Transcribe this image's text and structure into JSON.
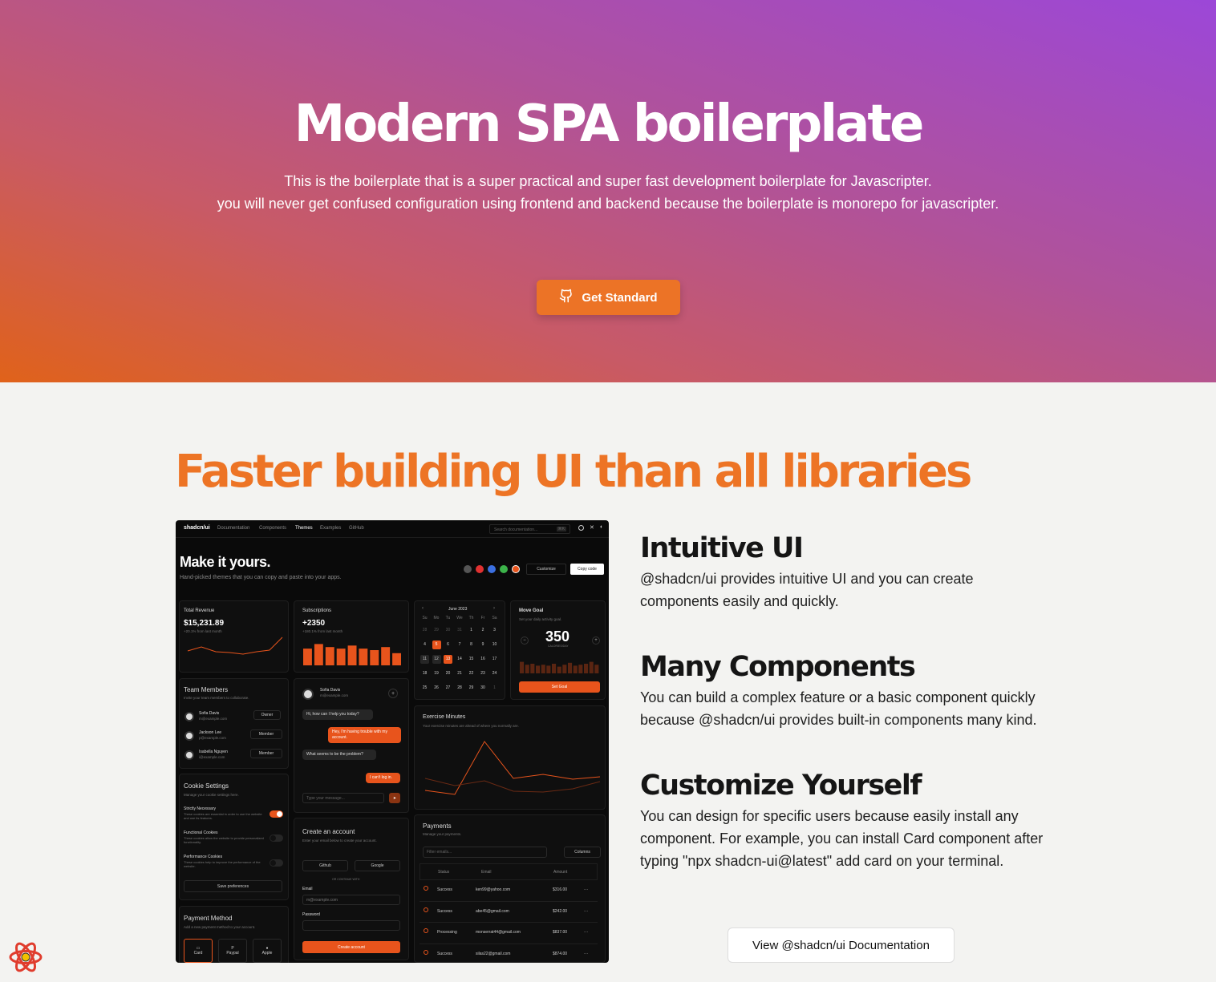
{
  "hero": {
    "title": "Modern SPA boilerplate",
    "subtitle_line1": "This is the boilerplate that is a super practical and super fast development boilerplate for Javascripter.",
    "subtitle_line2": "you will never get confused configuration using frontend and backend because the boilerplate is monorepo for javascripter.",
    "cta_label": "Get Standard",
    "cta_icon": "github-icon"
  },
  "section": {
    "title": "Faster building UI than all libraries"
  },
  "features": [
    {
      "title": "Intuitive UI",
      "text": "@shadcn/ui provides intuitive UI and you can create components easily and quickly."
    },
    {
      "title": "Many Components",
      "text": "You can build a complex feature or a basic component quickly because @shadcn/ui provides built-in components many kind."
    },
    {
      "title": "Customize Yourself",
      "text": "You can design for specific users because easily install any component. For example, you can install Card component after typing \"npx shadcn-ui@latest\" add card on your terminal."
    }
  ],
  "docs_button": "View @shadcn/ui Documentation",
  "colors": {
    "accent": "#ec7326",
    "title_orange": "#ed7425",
    "mock_orange": "#e8541c"
  },
  "mock": {
    "nav": {
      "brand": "shadcn/ui",
      "items": [
        "Documentation",
        "Components",
        "Themes",
        "Examples",
        "GitHub"
      ],
      "search": "Search documentation...",
      "shortcut": "⌘K"
    },
    "header": {
      "title": "Make it yours.",
      "subtitle": "Hand-picked themes that you can copy and paste into your apps.",
      "customize": "Customize",
      "copy": "Copy code"
    },
    "revenue": {
      "label": "Total Revenue",
      "value": "$15,231.89",
      "change": "+20.1% from last month"
    },
    "subs": {
      "label": "Subscriptions",
      "value": "+2350",
      "change": "+180.1% from last month"
    },
    "subs_bars": [
      0.55,
      0.7,
      0.6,
      0.55,
      0.65,
      0.55,
      0.5,
      0.6,
      0.4
    ],
    "calendar": {
      "month": "June 2023",
      "days": [
        "Su",
        "Mo",
        "Tu",
        "We",
        "Th",
        "Fr",
        "Sa"
      ],
      "cells": [
        "28",
        "29",
        "30",
        "31",
        "1",
        "2",
        "3",
        "4",
        "5",
        "6",
        "7",
        "8",
        "9",
        "10",
        "11",
        "12",
        "13",
        "14",
        "15",
        "16",
        "17",
        "18",
        "19",
        "20",
        "21",
        "22",
        "23",
        "24",
        "25",
        "26",
        "27",
        "28",
        "29",
        "30",
        "1"
      ]
    },
    "goal": {
      "title": "Move Goal",
      "subtitle": "Set your daily activity goal.",
      "value": "350",
      "unit": "CALORIES/DAY",
      "button": "Set Goal"
    },
    "goal_bars": [
      0.6,
      0.45,
      0.5,
      0.4,
      0.45,
      0.4,
      0.5,
      0.35,
      0.45,
      0.55,
      0.4,
      0.45,
      0.5,
      0.6,
      0.45
    ],
    "team": {
      "title": "Team Members",
      "subtitle": "Invite your team members to collaborate.",
      "members": [
        {
          "name": "Sofia Davis",
          "email": "m@example.com",
          "role": "Owner"
        },
        {
          "name": "Jackson Lee",
          "email": "p@example.com",
          "role": "Member"
        },
        {
          "name": "Isabella Nguyen",
          "email": "i@example.com",
          "role": "Member"
        }
      ]
    },
    "chat": {
      "name": "Sofia Davis",
      "email": "m@example.com",
      "m1": "Hi, how can I help you today?",
      "m2": "Hey, I'm having trouble with my account.",
      "m3": "What seems to be the problem?",
      "m4": "I can't log in.",
      "placeholder": "Type your message..."
    },
    "exercise": {
      "title": "Exercise Minutes",
      "subtitle": "Your exercise minutes are ahead of where you normally are."
    },
    "cookies": {
      "title": "Cookie Settings",
      "subtitle": "Manage your cookie settings here.",
      "s1": "Strictly Necessary",
      "s1d": "These cookies are essential in order to use the website and use its features.",
      "s2": "Functional Cookies",
      "s2d": "These cookies allow the website to provide personalized functionality.",
      "s3": "Performance Cookies",
      "s3d": "These cookies help to improve the performance of the website.",
      "button": "Save preferences"
    },
    "account": {
      "title": "Create an account",
      "subtitle": "Enter your email below to create your account.",
      "github": "Github",
      "google": "Google",
      "divider": "OR CONTINUE WITH",
      "email_label": "Email",
      "email_placeholder": "m@example.com",
      "password_label": "Password",
      "button": "Create account"
    },
    "payment_method": {
      "title": "Payment Method",
      "subtitle": "Add a new payment method to your account.",
      "options": [
        "Card",
        "Paypal",
        "Apple"
      ]
    },
    "payments": {
      "title": "Payments",
      "subtitle": "Manage your payments.",
      "filter": "Filter emails...",
      "columns": "Columns",
      "headers": [
        "Status",
        "Email",
        "Amount"
      ],
      "rows": [
        {
          "status": "Success",
          "email": "ken99@yahoo.com",
          "amount": "$316.00"
        },
        {
          "status": "Success",
          "email": "abe45@gmail.com",
          "amount": "$242.00"
        },
        {
          "status": "Processing",
          "email": "monserrat44@gmail.com",
          "amount": "$837.00"
        },
        {
          "status": "Success",
          "email": "silas22@gmail.com",
          "amount": "$874.00"
        }
      ]
    }
  }
}
